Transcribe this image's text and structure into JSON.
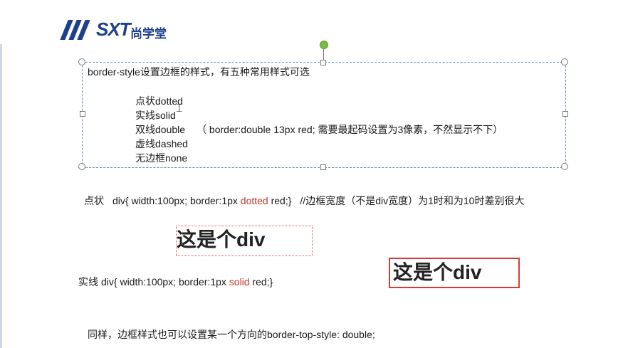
{
  "brand": {
    "logo": "SXT",
    "name": "尚学堂"
  },
  "textbox": {
    "title": "border-style设置边框的样式，有五种常用样式可选",
    "items": [
      {
        "name": "点状",
        "value": "dotted"
      },
      {
        "name": "实线",
        "value": "solid"
      },
      {
        "name": "双线",
        "value": "double",
        "note": "（ border:double 13px  red; 需要最起码设置为3像素，不然显示不下）"
      },
      {
        "name": "虚线",
        "value": "dashed"
      },
      {
        "name": "无边框",
        "value": "none"
      }
    ]
  },
  "dotted_line": {
    "label": "点状",
    "code_pre": "div{ width:100px; border:1px ",
    "keyword": "dotted",
    "code_post": " red;}",
    "comment": "//边框宽度（不是div宽度）为1时和为10时差别很大"
  },
  "demo_dotted_text": "这是个div",
  "solid_line": {
    "label": "实线",
    "code_pre": "div{ width:100px; border:1px ",
    "keyword": "solid",
    "code_post": " red;}"
  },
  "demo_solid_text": "这是个div",
  "footer_note": "同样，边框样式也可以设置某一个方向的border-top-style: double;"
}
